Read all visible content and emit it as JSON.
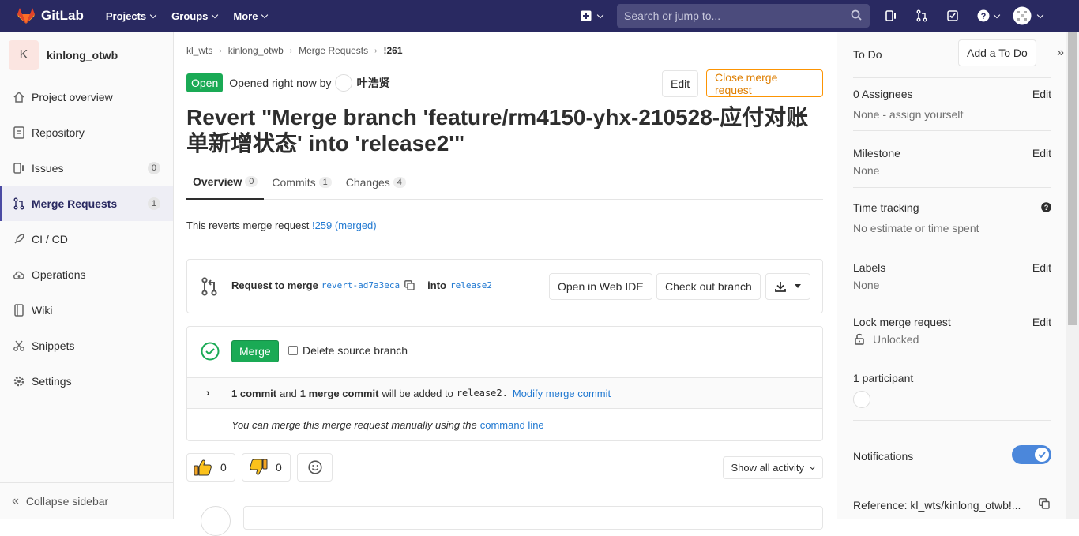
{
  "navbar": {
    "brand": "GitLab",
    "menu": [
      "Projects",
      "Groups",
      "More"
    ],
    "search_placeholder": "Search or jump to..."
  },
  "sidebar": {
    "project_letter": "K",
    "project_name": "kinlong_otwb",
    "items": [
      {
        "label": "Project overview",
        "icon": "home-icon"
      },
      {
        "label": "Repository",
        "icon": "doc-icon"
      },
      {
        "label": "Issues",
        "icon": "issues-icon",
        "badge": "0"
      },
      {
        "label": "Merge Requests",
        "icon": "merge-request-icon",
        "badge": "1"
      },
      {
        "label": "CI / CD",
        "icon": "rocket-icon"
      },
      {
        "label": "Operations",
        "icon": "cloud-gear-icon"
      },
      {
        "label": "Wiki",
        "icon": "book-icon"
      },
      {
        "label": "Snippets",
        "icon": "scissors-icon"
      },
      {
        "label": "Settings",
        "icon": "gear-icon"
      }
    ],
    "collapse_label": "Collapse sidebar"
  },
  "breadcrumb": [
    "kl_wts",
    "kinlong_otwb",
    "Merge Requests",
    "!261"
  ],
  "mr": {
    "status": "Open",
    "opened_text": "Opened right now by",
    "author": "叶浩贤",
    "edit_label": "Edit",
    "close_label": "Close merge request",
    "title": "Revert \"Merge branch 'feature/rm4150-yhx-210528-应付对账单新增状态' into 'release2'\"",
    "tabs": [
      {
        "label": "Overview",
        "count": "0"
      },
      {
        "label": "Commits",
        "count": "1"
      },
      {
        "label": "Changes",
        "count": "4"
      }
    ],
    "reverts_text": "This reverts merge request",
    "reverts_link": "!259 (merged)"
  },
  "widget": {
    "request_label": "Request to merge",
    "source_branch": "revert-ad7a3eca",
    "into_label": "into",
    "target_branch": "release2",
    "web_ide_label": "Open in Web IDE",
    "checkout_label": "Check out branch",
    "merge_label": "Merge",
    "delete_source_label": "Delete source branch",
    "commit_count": "1 commit",
    "and_text": "and",
    "merge_commit_count": "1 merge commit",
    "will_be_added": "will be added to",
    "added_branch": "release2.",
    "modify_label": "Modify merge commit",
    "manual_text": "You can merge this merge request manually using the",
    "command_line_label": "command line"
  },
  "reactions": {
    "thumbs_up_count": "0",
    "thumbs_down_count": "0",
    "activity_label": "Show all activity"
  },
  "right_sidebar": {
    "todo_label": "To Do",
    "add_todo_label": "Add a To Do",
    "assignees_title": "0 Assignees",
    "assignees_value": "None - assign yourself",
    "milestone_title": "Milestone",
    "milestone_value": "None",
    "time_title": "Time tracking",
    "time_value": "No estimate or time spent",
    "labels_title": "Labels",
    "labels_value": "None",
    "lock_title": "Lock merge request",
    "lock_value": "Unlocked",
    "participants_title": "1 participant",
    "notifications_title": "Notifications",
    "reference": "Reference: kl_wts/kinlong_otwb!...",
    "edit_label": "Edit"
  }
}
